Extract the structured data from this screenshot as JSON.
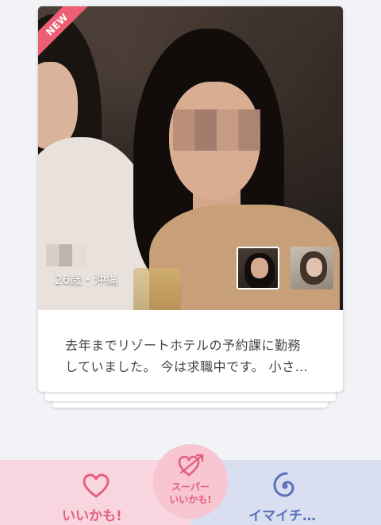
{
  "profile": {
    "badge": "NEW",
    "age_location": "26歳・沖縄",
    "bio": "去年までリゾートホテルの予約課に勤務\nしていました。 今は求職中です。 小さ…",
    "photo_count": 2,
    "selected_photo_index": 1
  },
  "actions": {
    "like_label": "いいかも!",
    "super_like_label": "スーパー\nいいかも!",
    "nope_label": "イマイチ…"
  },
  "icons": {
    "like": "heart-icon",
    "super_like": "heart-arrow-icon",
    "nope": "swirl-icon"
  },
  "colors": {
    "like_accent": "#e3607d",
    "nope_accent": "#5c6fb8",
    "badge": "#ec5f73"
  }
}
